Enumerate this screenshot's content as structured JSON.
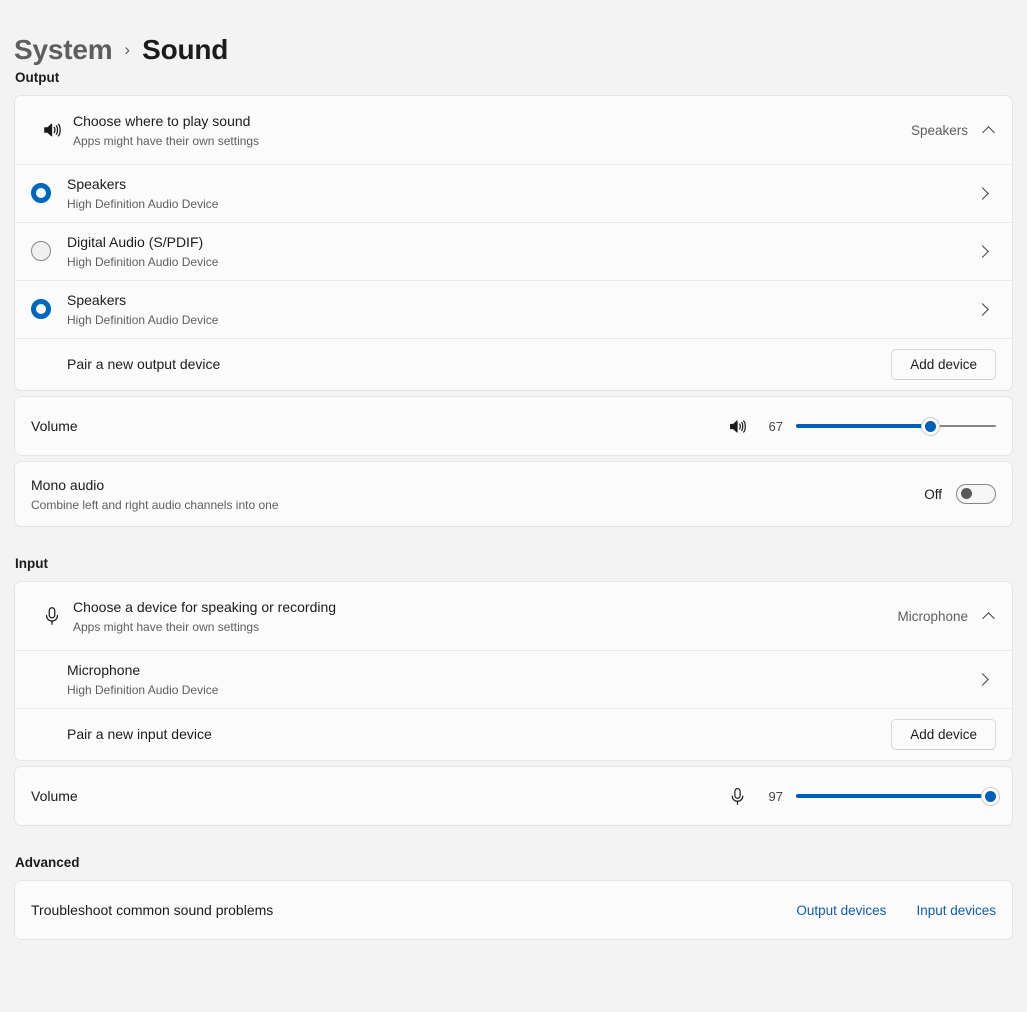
{
  "breadcrumb": {
    "root": "System",
    "separator": "›",
    "current": "Sound"
  },
  "sections": {
    "output": {
      "label": "Output",
      "chooser": {
        "icon": "speaker-icon",
        "title": "Choose where to play sound",
        "subtitle": "Apps might have their own settings",
        "value": "Speakers",
        "expanded": true
      },
      "devices": [
        {
          "name": "Speakers",
          "detail": "High Definition Audio Device",
          "selected": true
        },
        {
          "name": "Digital Audio (S/PDIF)",
          "detail": "High Definition Audio Device",
          "selected": false
        },
        {
          "name": "Speakers",
          "detail": "High Definition Audio Device",
          "selected": true
        }
      ],
      "pair": {
        "label": "Pair a new output device",
        "button": "Add device"
      },
      "volume": {
        "label": "Volume",
        "icon": "speaker-icon",
        "value": "67",
        "percent": 67,
        "min": 0,
        "max": 100
      },
      "mono": {
        "title": "Mono audio",
        "subtitle": "Combine left and right audio channels into one",
        "state": "Off",
        "on": false
      }
    },
    "input": {
      "label": "Input",
      "chooser": {
        "icon": "microphone-icon",
        "title": "Choose a device for speaking or recording",
        "subtitle": "Apps might have their own settings",
        "value": "Microphone",
        "expanded": true
      },
      "devices": [
        {
          "name": "Microphone",
          "detail": "High Definition Audio Device"
        }
      ],
      "pair": {
        "label": "Pair a new input device",
        "button": "Add device"
      },
      "volume": {
        "label": "Volume",
        "icon": "microphone-icon",
        "value": "97",
        "percent": 97,
        "min": 0,
        "max": 100
      }
    },
    "advanced": {
      "label": "Advanced",
      "troubleshoot": {
        "label": "Troubleshoot common sound problems",
        "links": [
          {
            "text": "Output devices"
          },
          {
            "text": "Input devices"
          }
        ]
      }
    }
  },
  "colors": {
    "accent": "#0067c0",
    "accent_track": "#005fb8",
    "link": "#0f5bb5",
    "page_bg": "#f3f3f3",
    "card_bg": "#fbfbfb"
  }
}
